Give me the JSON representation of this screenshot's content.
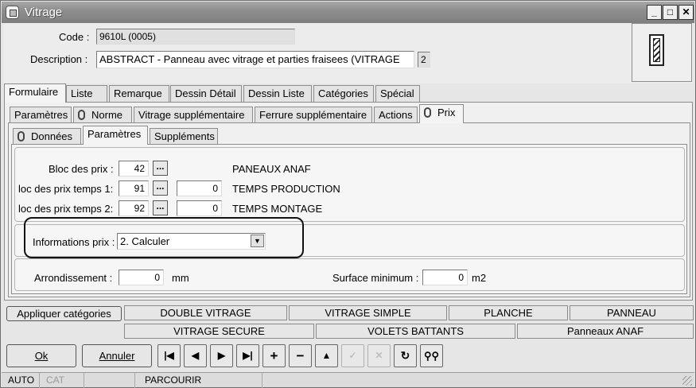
{
  "window": {
    "title": "Vitrage"
  },
  "header": {
    "code_label": "Code :",
    "code_value": "9610L (0005)",
    "description_label": "Description :",
    "description_value": "ABSTRACT - Panneau avec vitrage et parties fraisees (VITRAGE",
    "description_badge": "2"
  },
  "tabs_main": [
    "Formulaire",
    "Liste",
    "Remarque",
    "Dessin Détail",
    "Dessin Liste",
    "Catégories",
    "Spécial"
  ],
  "tabs_second": [
    "Paramètres",
    "Norme",
    "Vitrage supplémentaire",
    "Ferrure supplémentaire",
    "Actions",
    "Prix"
  ],
  "tabs_third": [
    "Données",
    "Paramètres",
    "Suppléments"
  ],
  "prix": {
    "rows": [
      {
        "label": "Bloc des prix :",
        "value": "42",
        "text": "PANEAUX ANAF"
      },
      {
        "label": "loc des prix temps 1:",
        "value": "91",
        "value2": "0",
        "text": "TEMPS PRODUCTION"
      },
      {
        "label": "loc des prix temps 2:",
        "value": "92",
        "value2": "0",
        "text": "TEMPS MONTAGE"
      }
    ],
    "info_label": "Informations prix :",
    "info_value": "2.  Calculer",
    "arrondissement_label": "Arrondissement :",
    "arrondissement_value": "0",
    "arrondissement_unit": "mm",
    "surface_label": "Surface minimum :",
    "surface_value": "0",
    "surface_unit": "m2"
  },
  "categories": {
    "apply_label": "Appliquer catégories",
    "row1": [
      "DOUBLE VITRAGE",
      "VITRAGE SIMPLE",
      "PLANCHE",
      "PANNEAU"
    ],
    "row2": [
      "VITRAGE SECURE",
      "VOLETS BATTANTS",
      "Panneaux ANAF"
    ]
  },
  "buttons": {
    "ok": "Ok",
    "annuler": "Annuler"
  },
  "statusbar": [
    "AUTO",
    "CAT",
    "",
    "PARCOURIR"
  ]
}
